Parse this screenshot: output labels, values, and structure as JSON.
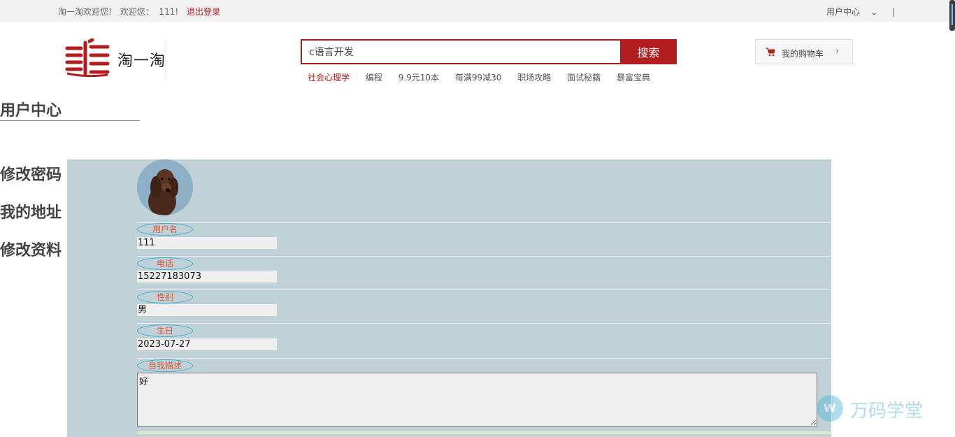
{
  "topbar": {
    "welcome": "淘一淘欢迎您!",
    "greeting": "欢迎您：",
    "username": "111!",
    "logout": "退出登录",
    "user_center": "用户中心",
    "chevron": "⌄",
    "separator": "|"
  },
  "logo": {
    "text": "淘一淘"
  },
  "search": {
    "value": "c语言开发",
    "button": "搜索"
  },
  "hotwords": [
    "社会心理学",
    "编程",
    "9.9元10本",
    "每满99减30",
    "职场攻略",
    "面试秘籍",
    "暴富宝典"
  ],
  "cart": {
    "icon": "cart-icon",
    "label": "我的购物车",
    "chevron": "›"
  },
  "sidebar": {
    "title": "用户中心",
    "items": [
      {
        "label": "修改密码"
      },
      {
        "label": "我的地址"
      },
      {
        "label": "修改资料"
      }
    ]
  },
  "profile": {
    "avatar": "dog-avatar",
    "fields": [
      {
        "label": "用户名",
        "value": "111"
      },
      {
        "label": "电话",
        "value": "15227183073"
      },
      {
        "label": "性别",
        "value": "男"
      },
      {
        "label": "生日",
        "value": "2023-07-27"
      }
    ],
    "description": {
      "label": "自我描述",
      "value": "好"
    }
  },
  "watermark": {
    "text": "万码学堂"
  },
  "colors": {
    "brand_red": "#b21e1e",
    "panel_bg": "#c0d1d8",
    "pill_border": "#3ab0d8",
    "pill_text": "#e0552d"
  }
}
